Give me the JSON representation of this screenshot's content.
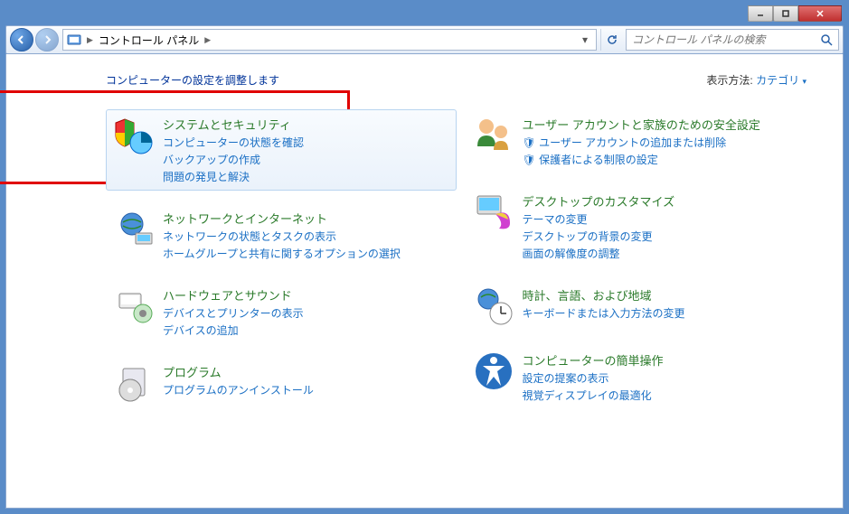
{
  "window": {
    "breadcrumb_text": "コントロール パネル",
    "search_placeholder": "コントロール パネルの検索"
  },
  "header": {
    "title": "コンピューターの設定を調整します",
    "view_by_label": "表示方法:",
    "view_by_value": "カテゴリ"
  },
  "left_categories": [
    {
      "title": "システムとセキュリティ",
      "links": [
        "コンピューターの状態を確認",
        "バックアップの作成",
        "問題の発見と解決"
      ]
    },
    {
      "title": "ネットワークとインターネット",
      "links": [
        "ネットワークの状態とタスクの表示",
        "ホームグループと共有に関するオプションの選択"
      ]
    },
    {
      "title": "ハードウェアとサウンド",
      "links": [
        "デバイスとプリンターの表示",
        "デバイスの追加"
      ]
    },
    {
      "title": "プログラム",
      "links": [
        "プログラムのアンインストール"
      ]
    }
  ],
  "right_categories": [
    {
      "title": "ユーザー アカウントと家族のための安全設定",
      "links": [
        "ユーザー アカウントの追加または削除",
        "保護者による制限の設定"
      ],
      "shields": [
        true,
        true
      ]
    },
    {
      "title": "デスクトップのカスタマイズ",
      "links": [
        "テーマの変更",
        "デスクトップの背景の変更",
        "画面の解像度の調整"
      ]
    },
    {
      "title": "時計、言語、および地域",
      "links": [
        "キーボードまたは入力方法の変更"
      ]
    },
    {
      "title": "コンピューターの簡単操作",
      "links": [
        "設定の提案の表示",
        "視覚ディスプレイの最適化"
      ]
    }
  ]
}
